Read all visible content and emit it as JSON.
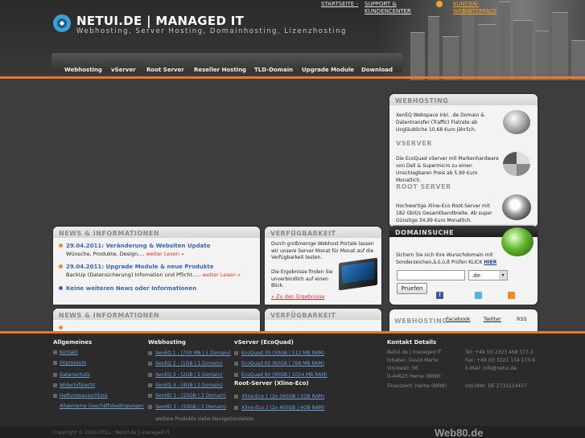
{
  "brand": {
    "name": "NETUI.DE | MANAGED IT",
    "tagline": "Webhosting, Server Hosting, Domainhosting, Lizenzhosting"
  },
  "toplinks": {
    "start": "STARTSEITE",
    "support": "SUPPORT & KUNDENCENTER",
    "kunden": "KUNDEN-WEBINTERFACE"
  },
  "nav": [
    "Webhosting",
    "vServer",
    "Root Server",
    "Reseller Hosting",
    "TLD-Domain",
    "Upgrade Module",
    "Download"
  ],
  "news": {
    "heading": "NEWS & INFORMATIONEN",
    "items": [
      {
        "title": "29.04.2011: Veränderung & Websiten Update",
        "text": "Wünsche, Produkte, Design....",
        "more": "weiter Lesen »"
      },
      {
        "title": "29.04.2011: Upgrade Module & neue Produkte",
        "text": "BackUp (Datensicherung) Infomation und Pflicht.....",
        "more": "weiter Lesen »"
      },
      {
        "title": "Keine weiteren News oder Informationen"
      }
    ]
  },
  "avail": {
    "heading": "VERFÜGBARKEIT",
    "text1": "Durch großmenige Webhost Portale lassen wir unsere Server Monat für Monat auf die Verfügbarkeit testen.",
    "text2": "Die Ergebnisse finden Sie unverbindlich auf einen Blick.",
    "link": "» Zu den Ergebnisse"
  },
  "news2": {
    "heading": "NEWS & INFORMATIONEN"
  },
  "avail2": {
    "heading": "VERFÜGBARKEIT"
  },
  "right": {
    "webhosting": {
      "heading": "WEBHOSTING",
      "text": "XenEQ Webspace inkl. .de Domain & Datentransfer (Traffic) Flatrate ab Ungläubliche 10,68 €uro Jährlich."
    },
    "vserver": {
      "heading": "VSERVER",
      "text": "Die EcoQuad vServer mit Markenhardware von Dell & Supermicro zu einen Unschlagbaren Preis ab 5,99 €uro Monatlich."
    },
    "rootserver": {
      "heading": "ROOT SERVER",
      "text": "Hochwertige Xline-Eco Root-Server mit 182 Gbit/s Gesamtbandbreite. Ab super Günstige 34,99 €uro Monatlich."
    },
    "domain": {
      "heading": "DOMAINSUCHE",
      "text": "Sichern Sie sich Ihre Wunschdomain mit Sonderzeichen,ä,ö,ü,ß Prüfen KLICK",
      "hier": "HIER",
      "tld": ".de",
      "button": "Pruefen",
      "input_value": ""
    },
    "social": {
      "facebook": "Facebook",
      "twitter": "Twitter",
      "rss": "RSS",
      "webhosting": "WEBHOSTING"
    }
  },
  "footer": {
    "allgemeines": {
      "heading": "Allgemeines",
      "links": [
        "Kontakt",
        "Impressum",
        "Datenschutz",
        "Widerrufsrecht",
        "Haftungsausschluss",
        "Allgemeine Geschäftsbedingungen"
      ]
    },
    "webhosting": {
      "heading": "Webhosting",
      "links": [
        "XenEQ 1 - (700 MB | 1 Domain)",
        "XenEQ 2 - (1GB | 1 Domain)",
        "XenEQ 3 - (2GB | 2 Domain)",
        "XenEQ 4 - (4GB | 2 Domain)",
        "XenHD 1 - (25GB | 3 Domain)",
        "XenHD 2 - (50GB | 3 Domain)"
      ],
      "more": "weitere Produkte siehe Navigationsleiste."
    },
    "vserver": {
      "heading": "vServer (EcoQuad)",
      "links": [
        "EcoQuad 30 (30GB | 512 MB RAM)",
        "EcoQuad 60 (60GB | 768 MB RAM)",
        "EcoQuad 90 (90GB | 1024 MB RAM)"
      ],
      "root_heading": "Root-Server (Xline-Eco)",
      "root_links": [
        "Xline-Eco 1 (2x 160GB | 1GB RAM)",
        "Xline-Eco 2 (2x 400GB | 4GB RAM)"
      ]
    },
    "kontakt": {
      "heading": "Kontakt Details",
      "lines": [
        "NetUi.de | managed IT",
        "Inhaber: David Marte",
        "Vinckestr. 56",
        "D-44623 Herne (NRW)",
        "Finanzamt: Herne (NRW)"
      ],
      "right_lines": [
        "Tel: +49 (0) 2323 468 377-3",
        "Fax: +49 (0) 3221 134 173-9",
        "E-Mail: info@netui.de",
        "",
        "Ust-IdNr: DE 2733124457"
      ]
    },
    "copyright": "Copyright © 2010-2011 · NetUi.de | managed IT",
    "web80": "Web80.de"
  }
}
